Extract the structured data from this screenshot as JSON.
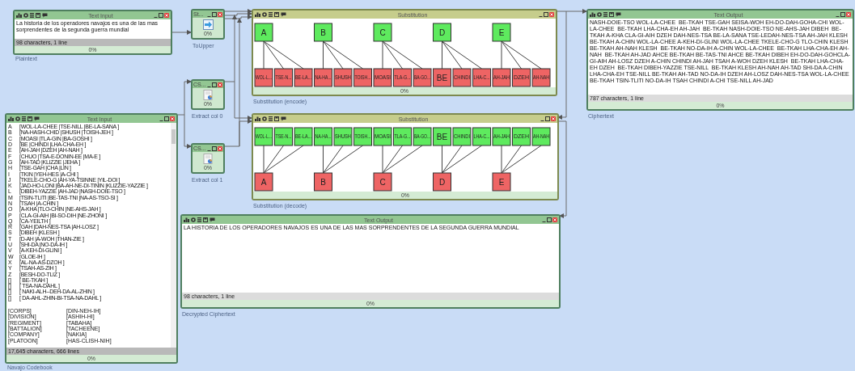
{
  "canvas": {
    "plaintext": {
      "kind": "text_input",
      "title": "Text Input",
      "text": "La historia de los operadores navajos es una de las mas sorprendentes de la segunda guerra mundial",
      "status": "98 characters,  1 line",
      "progress": "0%",
      "caption": "Plaintext"
    },
    "to_upper": {
      "kind": "arrow_component",
      "title": "St...",
      "progress": "0%",
      "caption": "ToUpper"
    },
    "extract_col_0": {
      "kind": "table_component",
      "title": "CS...",
      "progress": "0%",
      "caption": "Extract col 0"
    },
    "extract_col_1": {
      "kind": "table_component",
      "title": "CS...",
      "progress": "0%",
      "caption": "Extract col 1"
    },
    "substitution_encode": {
      "kind": "substitution_encode",
      "title": "Substitution",
      "groups": [
        {
          "source": "A",
          "targets": [
            "WOL-L...",
            "TSE-N...",
            "BE-LA..."
          ]
        },
        {
          "source": "B",
          "targets": [
            "NA-HA...",
            "SHUSH",
            "TOISH..."
          ]
        },
        {
          "source": "C",
          "targets": [
            "MOASI",
            "TLA-G...",
            "BA-GO..."
          ]
        },
        {
          "source": "D",
          "targets": [
            "BE",
            "CHINDI",
            "LHA-C..."
          ]
        },
        {
          "source": "E",
          "targets": [
            "AH-JAH",
            "DZEH",
            "AH-NAH"
          ]
        }
      ],
      "progress": "0%",
      "caption": "Substitution (encode)"
    },
    "substitution_decode": {
      "kind": "substitution_decode",
      "title": "Substitution",
      "groups": [
        {
          "source": "A",
          "targets": [
            "WOL-L...",
            "TSE-N...",
            "BE-LA..."
          ]
        },
        {
          "source": "B",
          "targets": [
            "NA-HA...",
            "SHUSH",
            "TOISH..."
          ]
        },
        {
          "source": "C",
          "targets": [
            "MOASI",
            "TLA-G...",
            "BA-GO..."
          ]
        },
        {
          "source": "D",
          "targets": [
            "BE",
            "CHINDI",
            "LHA-C..."
          ]
        },
        {
          "source": "E",
          "targets": [
            "AH-JAH",
            "DZEH",
            "AH-NAH"
          ]
        }
      ],
      "progress": "0%",
      "caption": "Substitution (decode)"
    },
    "ciphertext": {
      "kind": "text_output",
      "title": "Text Output",
      "text": "NASH-DOIE-TSO WOL-LA-CHEE  BE-TKAH TSE-GAH SEISA-WOH EH-DO-DAH-GOHA-CHI WOL-LA-CHEE  BE-TKAH LHA-CHA-EH AH-JAH  BE-TKAH NASH-DOIE-TSO NE-AHS-JAH DIBEH  BE-TKAH A-KHA CLA-GI-AIH DZEH DAH-NES-TSA BE-LA-SANA TSE-LEDAH-NES-TSA AH-JAH KLESH  BE-TKAH A-CHIN WOL-LA-CHEE A-KEH-DI-GLINI WOL-LA-CHEE TKELE-CHO-G TLO-CHIN KLESH  BE-TKAH AH-NAH KLESH  BE-TKAH NO-DA-IH A-CHIN WOL-LA-CHEE  BE-TKAH LHA-CHA-EH AH-NAH  BE-TKAH AH-JAD AHCE BE-TKAH BE-TAS-TNI AHCE BE-TKAH DIBEH EH-DO-DAH-GOHCLA-GI-AIH AH-LOSZ DZEH A-CHIN CHINDI AH-JAH TSAH A-WOH DZEH KLESH  BE-TKAH LHA-CHA-EH DZEH  BE-TKAH DIBEH-YAZZIE TSE-NILL  BE-TKAH KLESH AH-NAH AH-TAD SHI-DA A-CHIN LHA-CHA-EH TSE-NILL BE-TKAH AH-TAD NO-DA-IH DZEH AH-LOSZ DAH-NES-TSA WOL-LA-CHEE  BE-TKAH TSIN-TLITI NO-DA-IH TSAH CHINDI A-CHI TSE-NILL AH-JAD",
      "status": "787 characters,  1 line",
      "progress": "0%",
      "caption": "Ciphertext"
    },
    "codebook": {
      "kind": "text_input",
      "title": "Text Input",
      "rows": [
        {
          "key": "A",
          "value": "[WOL-LA-CHEE |TSE-NILL |BE-LA-SANA ]"
        },
        {
          "key": "B",
          "value": "[NA-HASH-CHID |SHUSH |TOISH-JEH ]"
        },
        {
          "key": "C",
          "value": "[MOASI |TLA-GIN |BA-GOSHI ]"
        },
        {
          "key": "D",
          "value": "[BE |CHINDI |LHA-CHA-EH ]"
        },
        {
          "key": "E",
          "value": "[AH-JAH |DZEH |AH-NAH ]"
        },
        {
          "key": "F",
          "value": "[CHUO |TSA-E-DONIN-EE |MA-E ]"
        },
        {
          "key": "G",
          "value": "[AH-TAD |KLIZZIE |JEHA ]"
        },
        {
          "key": "H",
          "value": "[TSE-GAH |CHA |LIN ]"
        },
        {
          "key": "I",
          "value": "[TKIN |YEH-HES |A-CHI ]"
        },
        {
          "key": "J",
          "value": "[TKELE-CHO-G |AH-YA-TSINNE |YIL-DOI ]"
        },
        {
          "key": "K",
          "value": "[JAD-HO-LONI |BA-AH-NE-DI-TININ |KLIZZIE-YAZZIE ]"
        },
        {
          "key": "L",
          "value": "[DIBEH-YAZZIE |AH-JAD |NASH-DOIE-TSO ]"
        },
        {
          "key": "M",
          "value": "[TSIN-TLITI |BE-TAS-TNI |NA-AS-TSO-SI ]"
        },
        {
          "key": "N",
          "value": "[TSAH |A-CHIN ]"
        },
        {
          "key": "O",
          "value": "[A-KHA |TLO-CHIN |NE-AHS-JAH ]"
        },
        {
          "key": "P",
          "value": "[CLA-GI-AIH |BI-SO-DIH |NE-ZHONI ]"
        },
        {
          "key": "Q",
          "value": "[CA-YEILTH ]"
        },
        {
          "key": "R",
          "value": "[GAH |DAH-NES-TSA |AH-LOSZ ]"
        },
        {
          "key": "S",
          "value": "[DIBEH |KLESH ]"
        },
        {
          "key": "T",
          "value": "[D-AH |A-WOH |THAN-ZIE ]"
        },
        {
          "key": "U",
          "value": "[SHI-DA |NO-DA-IH ]"
        },
        {
          "key": "V",
          "value": "[A-KEH-DI-GLINI ]"
        },
        {
          "key": "W",
          "value": "[GLOE-IH ]"
        },
        {
          "key": "X",
          "value": "[AL-NA-AS-DZOH ]"
        },
        {
          "key": "Y",
          "value": "[TSAH-AS-ZIH ]"
        },
        {
          "key": "Z",
          "value": "[BESH-DO-TLIZ ]"
        },
        {
          "key": "[]",
          "value": "[ BE-TKAH ]"
        },
        {
          "key": "[]",
          "value": "[ TSA-NA-DAHL ]"
        },
        {
          "key": "[]",
          "value": "[ NAKI-ALH--DEH-DA-AL-ZHIN ]"
        },
        {
          "key": "[]",
          "value": "[ DA-AHL-ZHIN-BI-TSA-NA-DAHL ]"
        }
      ],
      "term_rows": [
        {
          "key": "[CORPS]",
          "value": "[DIN-NEH-IH]"
        },
        {
          "key": "[DIVISION]",
          "value": "[ASHIH-HI]"
        },
        {
          "key": "[REGIMENT]",
          "value": "[TABAHA]"
        },
        {
          "key": "[BATTALION]",
          "value": "[TACHEENE]"
        },
        {
          "key": "[COMPANY]",
          "value": "[NAKIA]"
        },
        {
          "key": "[PLATOON]",
          "value": "[HAS-CLISH-NIH]"
        }
      ],
      "status": "17,645 characters,  666 lines",
      "progress": "0%",
      "caption": "Navajo Codebook"
    },
    "decrypted": {
      "kind": "text_output",
      "title": "Text Output",
      "text": "LA HISTORIA DE LOS OPERADORES NAVAJOS ES UNA DE LAS MAS SORPRENDENTES DE LA SEGUNDA GUERRA MUNDIAL",
      "status": "98 characters,  1 line",
      "progress": "0%",
      "caption": "Decrypted Ciphertext"
    }
  }
}
